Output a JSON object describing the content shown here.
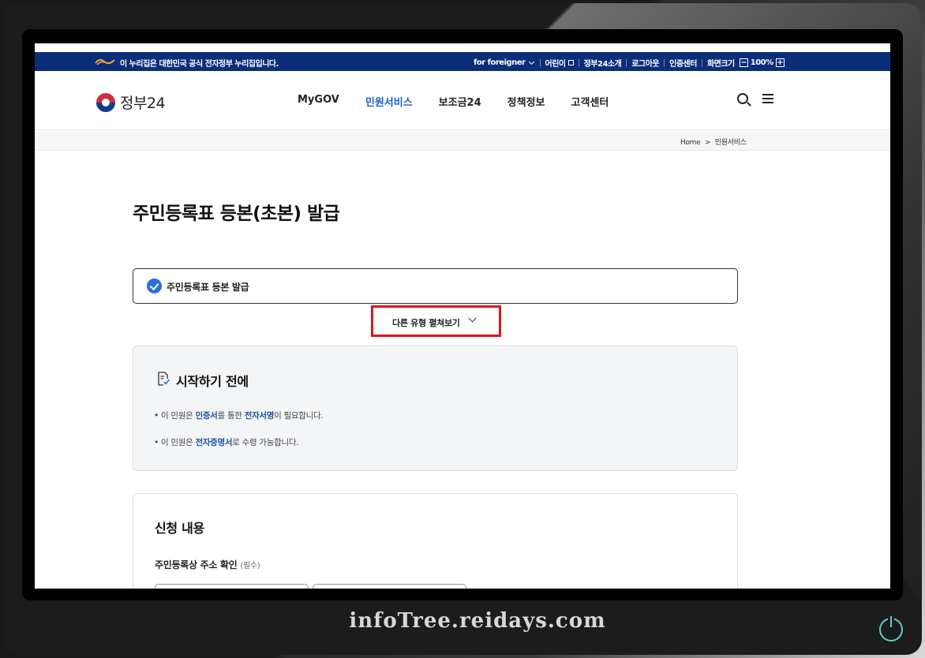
{
  "banner": {
    "notice": "이 누리집은 대한민국 공식 전자정부 누리집입니다.",
    "links": [
      "for foreigner",
      "어린이",
      "정부24소개",
      "로그아웃",
      "인증센터",
      "화면크기"
    ],
    "zoom_minus": "−",
    "zoom_level": "100%",
    "zoom_plus": "+"
  },
  "header": {
    "logo_text": "정부24",
    "nav": [
      "MyGOV",
      "민원서비스",
      "보조금24",
      "정책정보",
      "고객센터"
    ],
    "active_nav_index": 1
  },
  "breadcrumb": {
    "home": "Home",
    "separator": ">",
    "current": "민원서비스"
  },
  "page": {
    "title": "주민등록표 등본(초본) 발급",
    "selected_type": "주민등록표 등본 발급",
    "more_types_label": "다른 유형 펼쳐보기"
  },
  "before_start": {
    "title": "시작하기 전에",
    "bullet1": {
      "p1": "• 이 민원은 ",
      "b1": "인증서",
      "p2": "를 통한 ",
      "b2": "전자서명",
      "p3": "이 필요합니다."
    },
    "bullet2": {
      "p1": "• 이 민원은 ",
      "b1": "전자증명서",
      "p2": "로 수령 가능합니다."
    }
  },
  "application": {
    "title": "신청 내용",
    "address_label": "주민등록상 주소 확인",
    "required": "(필수)"
  },
  "watermark": "infoTree.reidays.com",
  "colors": {
    "banner_bg": "#0b2e7a",
    "active_nav": "#1a5fc6",
    "highlight_border": "#e3121b",
    "check_blue": "#2b6fde"
  }
}
